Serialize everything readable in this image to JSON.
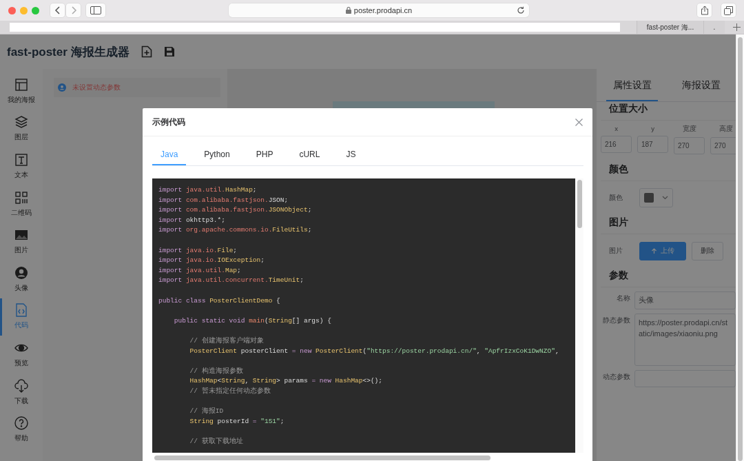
{
  "browser": {
    "url": "poster.prodapi.cn",
    "tabs": [
      {
        "label": "fast-poster 海..."
      },
      {
        "label": "."
      }
    ]
  },
  "app": {
    "title": "fast-poster 海报生成器"
  },
  "sidebar": {
    "items": [
      {
        "label": "我的海报",
        "kind": "layout",
        "selected": false
      },
      {
        "label": "图层",
        "kind": "layers",
        "selected": false
      },
      {
        "label": "文本",
        "kind": "text",
        "selected": false
      },
      {
        "label": "二维码",
        "kind": "qrcode",
        "selected": false
      },
      {
        "label": "图片",
        "kind": "image",
        "selected": false
      },
      {
        "label": "头像",
        "kind": "avatar",
        "selected": false
      },
      {
        "label": "代码",
        "kind": "code",
        "selected": true
      },
      {
        "label": "预览",
        "kind": "eye",
        "selected": false
      },
      {
        "label": "下载",
        "kind": "download",
        "selected": false
      },
      {
        "label": "帮助",
        "kind": "help",
        "selected": false
      }
    ]
  },
  "params_panel": {
    "alert": "未设置动态参数"
  },
  "properties": {
    "tabs": [
      {
        "label": "属性设置",
        "selected": true
      },
      {
        "label": "海报设置",
        "selected": false
      }
    ],
    "position": {
      "heading": "位置大小",
      "fields": [
        {
          "label": "x",
          "value": "216"
        },
        {
          "label": "y",
          "value": "187"
        },
        {
          "label": "宽度",
          "value": "270"
        },
        {
          "label": "高度",
          "value": "270"
        }
      ]
    },
    "color": {
      "heading": "颜色",
      "label": "颜色"
    },
    "image": {
      "heading": "图片",
      "label": "图片",
      "buttons": [
        {
          "label": "上传",
          "kind": "upload"
        },
        {
          "label": "删除",
          "kind": "plain"
        }
      ]
    },
    "params": {
      "heading": "参数",
      "fields": [
        {
          "label": "名称",
          "kind": "input",
          "value": "头像"
        },
        {
          "label": "静态参数",
          "kind": "textarea",
          "value": "https://poster.prodapi.cn/static/images/xiaoniu.png"
        },
        {
          "label": "动态参数",
          "kind": "input"
        }
      ]
    }
  },
  "modal": {
    "title": "示例代码",
    "tabs": [
      {
        "label": "Java",
        "selected": true
      },
      {
        "label": "Python",
        "selected": false
      },
      {
        "label": "PHP",
        "selected": false
      },
      {
        "label": "cURL",
        "selected": false
      },
      {
        "label": "JS",
        "selected": false
      }
    ],
    "code_blocks": [
      [
        [
          {
            "kind": "keyword",
            "text": "import "
          },
          {
            "kind": "package",
            "text": "java.util."
          },
          {
            "kind": "class",
            "text": "HashMap"
          },
          {
            "kind": "plain",
            "text": ";"
          }
        ],
        [
          {
            "kind": "keyword",
            "text": "import "
          },
          {
            "kind": "package",
            "text": "com.alibaba.fastjson."
          },
          {
            "kind": "plain",
            "text": "JSON;"
          }
        ],
        [
          {
            "kind": "keyword",
            "text": "import "
          },
          {
            "kind": "package",
            "text": "com.alibaba.fastjson."
          },
          {
            "kind": "class",
            "text": "JSONObject"
          },
          {
            "kind": "plain",
            "text": ";"
          }
        ],
        [
          {
            "kind": "keyword",
            "text": "import "
          },
          {
            "kind": "plain",
            "text": "okhttp3.*;"
          }
        ],
        [
          {
            "kind": "keyword",
            "text": "import "
          },
          {
            "kind": "package",
            "text": "org.apache.commons.io."
          },
          {
            "kind": "class",
            "text": "FileUtils"
          },
          {
            "kind": "plain",
            "text": ";"
          }
        ]
      ],
      [
        [
          {
            "kind": "keyword",
            "text": "import "
          },
          {
            "kind": "package",
            "text": "java.io."
          },
          {
            "kind": "class",
            "text": "File"
          },
          {
            "kind": "plain",
            "text": ";"
          }
        ],
        [
          {
            "kind": "keyword",
            "text": "import "
          },
          {
            "kind": "package",
            "text": "java.io."
          },
          {
            "kind": "class",
            "text": "IOException"
          },
          {
            "kind": "plain",
            "text": ";"
          }
        ],
        [
          {
            "kind": "keyword",
            "text": "import "
          },
          {
            "kind": "package",
            "text": "java.util."
          },
          {
            "kind": "class",
            "text": "Map"
          },
          {
            "kind": "plain",
            "text": ";"
          }
        ],
        [
          {
            "kind": "keyword",
            "text": "import "
          },
          {
            "kind": "package",
            "text": "java.util.concurrent."
          },
          {
            "kind": "class",
            "text": "TimeUnit"
          },
          {
            "kind": "plain",
            "text": ";"
          }
        ]
      ],
      [
        [
          {
            "kind": "keyword",
            "text": "public class "
          },
          {
            "kind": "class",
            "text": "PosterClientDemo"
          },
          {
            "kind": "plain",
            "text": " {"
          }
        ]
      ],
      [
        [
          {
            "kind": "keyword",
            "text": "    public static void "
          },
          {
            "kind": "function",
            "text": "main"
          },
          {
            "kind": "plain",
            "text": "("
          },
          {
            "kind": "class",
            "text": "String"
          },
          {
            "kind": "plain",
            "text": "[] args) {"
          }
        ]
      ],
      [
        [
          {
            "kind": "comment",
            "text": "        // 创建海报客户端对象"
          }
        ],
        [
          {
            "kind": "class",
            "text": "        PosterClient"
          },
          {
            "kind": "plain",
            "text": " posterClient "
          },
          {
            "kind": "keyword",
            "text": "= new "
          },
          {
            "kind": "class",
            "text": "PosterClient"
          },
          {
            "kind": "plain",
            "text": "("
          },
          {
            "kind": "string",
            "text": "\"https://poster.prodapi.cn/\""
          },
          {
            "kind": "plain",
            "text": ", "
          },
          {
            "kind": "string",
            "text": "\"ApfrIzxCoK1DwNZO\""
          },
          {
            "kind": "plain",
            "text": ","
          }
        ]
      ],
      [
        [
          {
            "kind": "comment",
            "text": "        // 构造海报参数"
          }
        ],
        [
          {
            "kind": "class",
            "text": "        HashMap"
          },
          {
            "kind": "plain",
            "text": "<"
          },
          {
            "kind": "class",
            "text": "String"
          },
          {
            "kind": "plain",
            "text": ", "
          },
          {
            "kind": "class",
            "text": "String"
          },
          {
            "kind": "plain",
            "text": "> params "
          },
          {
            "kind": "keyword",
            "text": "= new "
          },
          {
            "kind": "class",
            "text": "HashMap"
          },
          {
            "kind": "plain",
            "text": "<>();"
          }
        ],
        [
          {
            "kind": "comment",
            "text": "        // 暂未指定任何动态参数"
          }
        ]
      ],
      [
        [
          {
            "kind": "comment",
            "text": "        // 海报ID"
          }
        ],
        [
          {
            "kind": "class",
            "text": "        String"
          },
          {
            "kind": "plain",
            "text": " posterId "
          },
          {
            "kind": "keyword",
            "text": "= "
          },
          {
            "kind": "string",
            "text": "\"151\""
          },
          {
            "kind": "plain",
            "text": ";"
          }
        ]
      ],
      [
        [
          {
            "kind": "comment",
            "text": "        // 获取下载地址"
          }
        ]
      ]
    ]
  }
}
